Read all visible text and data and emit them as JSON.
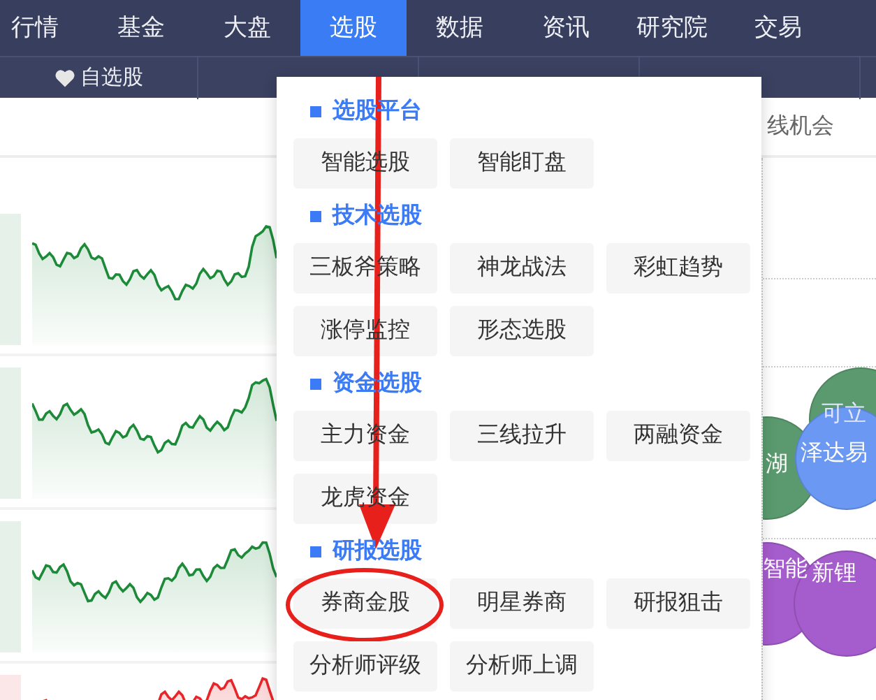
{
  "nav": [
    {
      "label": "行情",
      "selected": false
    },
    {
      "label": "基金",
      "selected": false
    },
    {
      "label": "大盘",
      "selected": false
    },
    {
      "label": "选股",
      "selected": true
    },
    {
      "label": "数据",
      "selected": false
    },
    {
      "label": "资讯",
      "selected": false
    },
    {
      "label": "研究院",
      "selected": false
    },
    {
      "label": "交易",
      "selected": false
    }
  ],
  "subnav": [
    {
      "label": "自选股",
      "kind": "favorites"
    }
  ],
  "toolbar": {
    "label": "线机会"
  },
  "sparkline_rows": [
    {
      "color": "#1d8a3a"
    },
    {
      "color": "#1d8a3a"
    },
    {
      "color": "#1d8a3a"
    },
    {
      "color": "#e8262a"
    }
  ],
  "bubbles": [
    {
      "label": "可立",
      "color": "#5a9a6e"
    },
    {
      "label": "湖",
      "color": "#5a9a6e"
    },
    {
      "label": "泽达易",
      "color": "#6a98f2"
    },
    {
      "label": "智能",
      "color": "#a55ccc"
    },
    {
      "label": "新锂",
      "color": "#a55ccc"
    }
  ],
  "menu": {
    "sections": [
      {
        "title": "选股平台",
        "items": [
          {
            "label": "智能选股",
            "circled": false
          },
          {
            "label": "智能盯盘",
            "circled": false
          }
        ]
      },
      {
        "title": "技术选股",
        "items": [
          {
            "label": "三板斧策略",
            "circled": false
          },
          {
            "label": "神龙战法",
            "circled": false
          },
          {
            "label": "彩虹趋势",
            "circled": false
          },
          {
            "label": "涨停监控",
            "circled": false
          },
          {
            "label": "形态选股",
            "circled": false
          }
        ]
      },
      {
        "title": "资金选股",
        "items": [
          {
            "label": "主力资金",
            "circled": false
          },
          {
            "label": "三线拉升",
            "circled": false
          },
          {
            "label": "两融资金",
            "circled": false
          },
          {
            "label": "龙虎资金",
            "circled": false
          }
        ]
      },
      {
        "title": "研报选股",
        "items": [
          {
            "label": "券商金股",
            "circled": true
          },
          {
            "label": "明星券商",
            "circled": false
          },
          {
            "label": "研报狙击",
            "circled": false
          },
          {
            "label": "分析师评级",
            "circled": false
          },
          {
            "label": "分析师上调",
            "circled": false
          }
        ]
      }
    ]
  }
}
